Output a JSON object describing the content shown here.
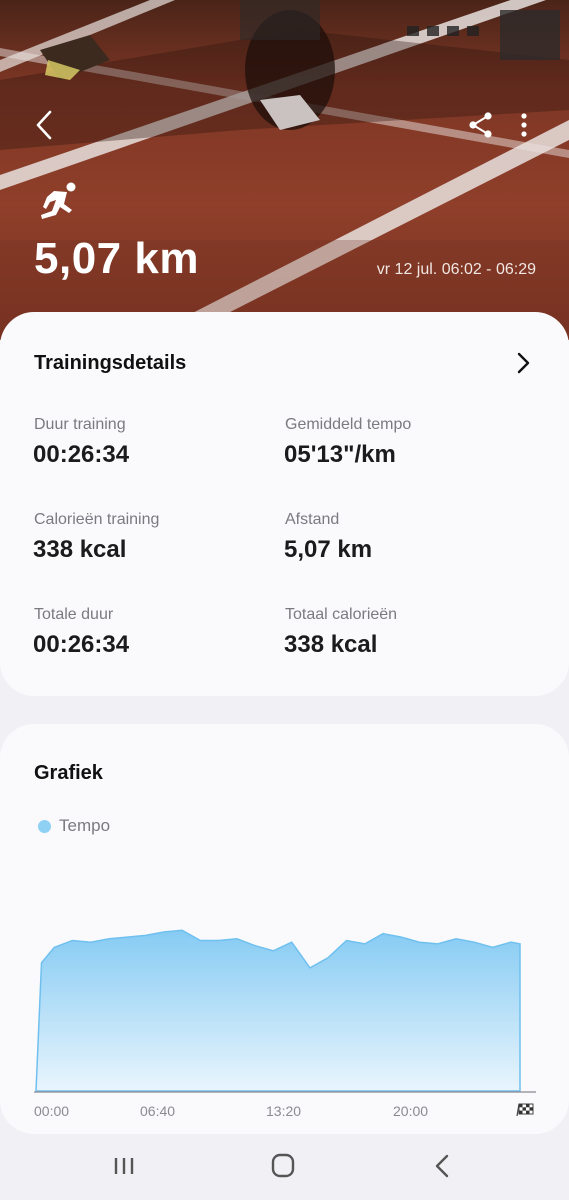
{
  "header": {
    "distance": "5,07 km",
    "date_range": "vr 12 jul. 06:02 - 06:29"
  },
  "icons": {
    "back": "chevron-left-icon",
    "share": "share-icon",
    "more": "more-vertical-icon",
    "activity": "running-icon",
    "details": "chevron-right-icon"
  },
  "details": {
    "title": "Trainingsdetails",
    "stats": [
      {
        "label": "Duur training",
        "value": "00:26:34"
      },
      {
        "label": "Gemiddeld tempo",
        "value": "05'13\"/km"
      },
      {
        "label": "Calorieën training",
        "value": "338 kcal"
      },
      {
        "label": "Afstand",
        "value": "5,07 km"
      },
      {
        "label": "Totale duur",
        "value": "00:26:34"
      },
      {
        "label": "Totaal calorieën",
        "value": "338 kcal"
      }
    ]
  },
  "graph": {
    "title": "Grafiek",
    "legend": "Tempo"
  },
  "chart_data": {
    "type": "area",
    "title": "Grafiek",
    "series": [
      {
        "name": "Tempo",
        "color": "#8fd0f5"
      }
    ],
    "x_ticks": [
      "00:00",
      "06:40",
      "13:20",
      "20:00"
    ],
    "finish_marker": "checkered-flag-icon",
    "x": [
      0,
      0.3,
      1,
      2,
      3,
      4,
      5,
      6,
      7,
      8,
      9,
      10,
      11,
      12,
      13,
      14,
      15,
      16,
      17,
      18,
      19,
      20,
      21,
      22,
      23,
      24,
      25,
      26,
      26.5
    ],
    "values": [
      0,
      0.75,
      0.84,
      0.88,
      0.87,
      0.89,
      0.9,
      0.91,
      0.93,
      0.94,
      0.88,
      0.88,
      0.89,
      0.85,
      0.82,
      0.87,
      0.72,
      0.78,
      0.88,
      0.86,
      0.92,
      0.9,
      0.87,
      0.86,
      0.89,
      0.87,
      0.84,
      0.87,
      0.86
    ],
    "ylim": [
      0,
      1
    ],
    "grid": false
  },
  "navbar": {
    "recent": "recent-apps-icon",
    "home": "home-icon",
    "back": "back-icon"
  }
}
